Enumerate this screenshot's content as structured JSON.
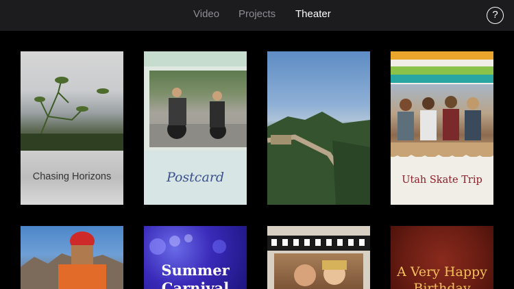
{
  "tabs": [
    {
      "label": "Video"
    },
    {
      "label": "Projects"
    },
    {
      "label": "Theater",
      "active": true
    }
  ],
  "help_label": "?",
  "theater_items": [
    {
      "title": "Chasing Horizons"
    },
    {
      "title": "Postcard"
    },
    {
      "title": ""
    },
    {
      "title": "Utah Skate Trip"
    },
    {
      "title": ""
    },
    {
      "title": "Summer Carnival"
    },
    {
      "title": ""
    },
    {
      "title": "A Very Happy Birthday"
    }
  ],
  "colors": {
    "topbar": "#1c1c1e",
    "inactive_tab": "#8e8e93",
    "active_tab": "#ffffff",
    "background": "#000000"
  },
  "icons": {
    "help": "question-mark-icon"
  }
}
